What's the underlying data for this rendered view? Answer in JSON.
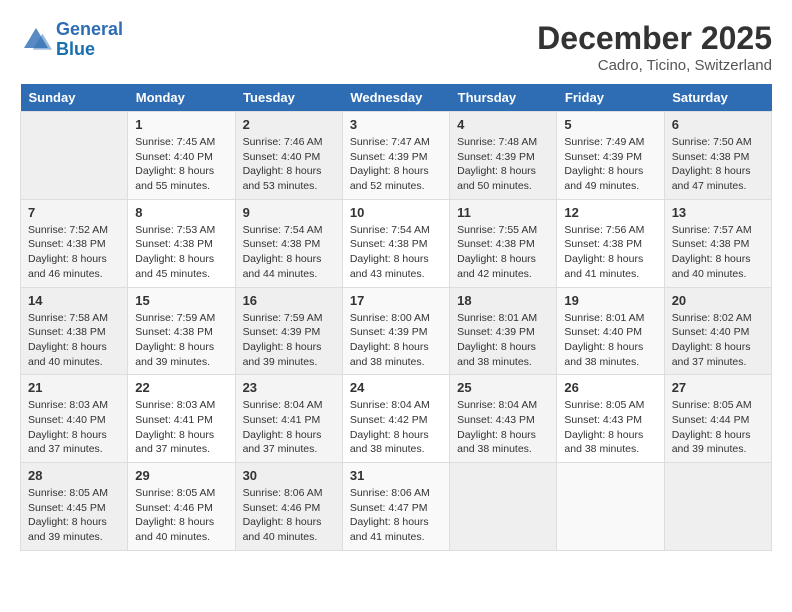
{
  "logo": {
    "line1": "General",
    "line2": "Blue"
  },
  "title": "December 2025",
  "subtitle": "Cadro, Ticino, Switzerland",
  "days_of_week": [
    "Sunday",
    "Monday",
    "Tuesday",
    "Wednesday",
    "Thursday",
    "Friday",
    "Saturday"
  ],
  "weeks": [
    [
      {
        "day": "",
        "sunrise": "",
        "sunset": "",
        "daylight": ""
      },
      {
        "day": "1",
        "sunrise": "Sunrise: 7:45 AM",
        "sunset": "Sunset: 4:40 PM",
        "daylight": "Daylight: 8 hours and 55 minutes."
      },
      {
        "day": "2",
        "sunrise": "Sunrise: 7:46 AM",
        "sunset": "Sunset: 4:40 PM",
        "daylight": "Daylight: 8 hours and 53 minutes."
      },
      {
        "day": "3",
        "sunrise": "Sunrise: 7:47 AM",
        "sunset": "Sunset: 4:39 PM",
        "daylight": "Daylight: 8 hours and 52 minutes."
      },
      {
        "day": "4",
        "sunrise": "Sunrise: 7:48 AM",
        "sunset": "Sunset: 4:39 PM",
        "daylight": "Daylight: 8 hours and 50 minutes."
      },
      {
        "day": "5",
        "sunrise": "Sunrise: 7:49 AM",
        "sunset": "Sunset: 4:39 PM",
        "daylight": "Daylight: 8 hours and 49 minutes."
      },
      {
        "day": "6",
        "sunrise": "Sunrise: 7:50 AM",
        "sunset": "Sunset: 4:38 PM",
        "daylight": "Daylight: 8 hours and 47 minutes."
      }
    ],
    [
      {
        "day": "7",
        "sunrise": "Sunrise: 7:52 AM",
        "sunset": "Sunset: 4:38 PM",
        "daylight": "Daylight: 8 hours and 46 minutes."
      },
      {
        "day": "8",
        "sunrise": "Sunrise: 7:53 AM",
        "sunset": "Sunset: 4:38 PM",
        "daylight": "Daylight: 8 hours and 45 minutes."
      },
      {
        "day": "9",
        "sunrise": "Sunrise: 7:54 AM",
        "sunset": "Sunset: 4:38 PM",
        "daylight": "Daylight: 8 hours and 44 minutes."
      },
      {
        "day": "10",
        "sunrise": "Sunrise: 7:54 AM",
        "sunset": "Sunset: 4:38 PM",
        "daylight": "Daylight: 8 hours and 43 minutes."
      },
      {
        "day": "11",
        "sunrise": "Sunrise: 7:55 AM",
        "sunset": "Sunset: 4:38 PM",
        "daylight": "Daylight: 8 hours and 42 minutes."
      },
      {
        "day": "12",
        "sunrise": "Sunrise: 7:56 AM",
        "sunset": "Sunset: 4:38 PM",
        "daylight": "Daylight: 8 hours and 41 minutes."
      },
      {
        "day": "13",
        "sunrise": "Sunrise: 7:57 AM",
        "sunset": "Sunset: 4:38 PM",
        "daylight": "Daylight: 8 hours and 40 minutes."
      }
    ],
    [
      {
        "day": "14",
        "sunrise": "Sunrise: 7:58 AM",
        "sunset": "Sunset: 4:38 PM",
        "daylight": "Daylight: 8 hours and 40 minutes."
      },
      {
        "day": "15",
        "sunrise": "Sunrise: 7:59 AM",
        "sunset": "Sunset: 4:38 PM",
        "daylight": "Daylight: 8 hours and 39 minutes."
      },
      {
        "day": "16",
        "sunrise": "Sunrise: 7:59 AM",
        "sunset": "Sunset: 4:39 PM",
        "daylight": "Daylight: 8 hours and 39 minutes."
      },
      {
        "day": "17",
        "sunrise": "Sunrise: 8:00 AM",
        "sunset": "Sunset: 4:39 PM",
        "daylight": "Daylight: 8 hours and 38 minutes."
      },
      {
        "day": "18",
        "sunrise": "Sunrise: 8:01 AM",
        "sunset": "Sunset: 4:39 PM",
        "daylight": "Daylight: 8 hours and 38 minutes."
      },
      {
        "day": "19",
        "sunrise": "Sunrise: 8:01 AM",
        "sunset": "Sunset: 4:40 PM",
        "daylight": "Daylight: 8 hours and 38 minutes."
      },
      {
        "day": "20",
        "sunrise": "Sunrise: 8:02 AM",
        "sunset": "Sunset: 4:40 PM",
        "daylight": "Daylight: 8 hours and 37 minutes."
      }
    ],
    [
      {
        "day": "21",
        "sunrise": "Sunrise: 8:03 AM",
        "sunset": "Sunset: 4:40 PM",
        "daylight": "Daylight: 8 hours and 37 minutes."
      },
      {
        "day": "22",
        "sunrise": "Sunrise: 8:03 AM",
        "sunset": "Sunset: 4:41 PM",
        "daylight": "Daylight: 8 hours and 37 minutes."
      },
      {
        "day": "23",
        "sunrise": "Sunrise: 8:04 AM",
        "sunset": "Sunset: 4:41 PM",
        "daylight": "Daylight: 8 hours and 37 minutes."
      },
      {
        "day": "24",
        "sunrise": "Sunrise: 8:04 AM",
        "sunset": "Sunset: 4:42 PM",
        "daylight": "Daylight: 8 hours and 38 minutes."
      },
      {
        "day": "25",
        "sunrise": "Sunrise: 8:04 AM",
        "sunset": "Sunset: 4:43 PM",
        "daylight": "Daylight: 8 hours and 38 minutes."
      },
      {
        "day": "26",
        "sunrise": "Sunrise: 8:05 AM",
        "sunset": "Sunset: 4:43 PM",
        "daylight": "Daylight: 8 hours and 38 minutes."
      },
      {
        "day": "27",
        "sunrise": "Sunrise: 8:05 AM",
        "sunset": "Sunset: 4:44 PM",
        "daylight": "Daylight: 8 hours and 39 minutes."
      }
    ],
    [
      {
        "day": "28",
        "sunrise": "Sunrise: 8:05 AM",
        "sunset": "Sunset: 4:45 PM",
        "daylight": "Daylight: 8 hours and 39 minutes."
      },
      {
        "day": "29",
        "sunrise": "Sunrise: 8:05 AM",
        "sunset": "Sunset: 4:46 PM",
        "daylight": "Daylight: 8 hours and 40 minutes."
      },
      {
        "day": "30",
        "sunrise": "Sunrise: 8:06 AM",
        "sunset": "Sunset: 4:46 PM",
        "daylight": "Daylight: 8 hours and 40 minutes."
      },
      {
        "day": "31",
        "sunrise": "Sunrise: 8:06 AM",
        "sunset": "Sunset: 4:47 PM",
        "daylight": "Daylight: 8 hours and 41 minutes."
      },
      {
        "day": "",
        "sunrise": "",
        "sunset": "",
        "daylight": ""
      },
      {
        "day": "",
        "sunrise": "",
        "sunset": "",
        "daylight": ""
      },
      {
        "day": "",
        "sunrise": "",
        "sunset": "",
        "daylight": ""
      }
    ]
  ]
}
